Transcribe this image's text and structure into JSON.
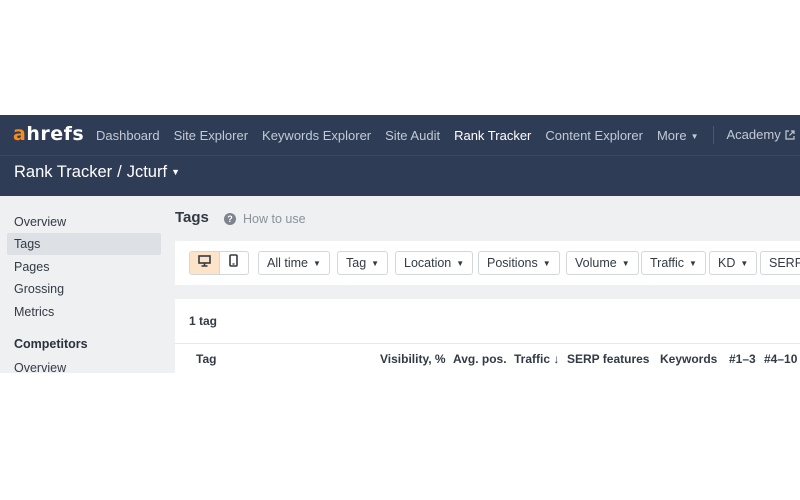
{
  "logo": {
    "first_letter": "a",
    "rest": "hrefs"
  },
  "nav": {
    "items": [
      {
        "label": "Dashboard"
      },
      {
        "label": "Site Explorer"
      },
      {
        "label": "Keywords Explorer"
      },
      {
        "label": "Site Audit"
      },
      {
        "label": "Rank Tracker"
      },
      {
        "label": "Content Explorer"
      }
    ],
    "more_label": "More",
    "academy_label": "Academy",
    "active": "Rank Tracker"
  },
  "project": {
    "tool": "Rank Tracker",
    "separator": "/",
    "name": "Jcturf"
  },
  "sidebar": {
    "items": [
      {
        "label": "Overview"
      },
      {
        "label": "Tags"
      },
      {
        "label": "Pages"
      },
      {
        "label": "Grossing"
      },
      {
        "label": "Metrics"
      }
    ],
    "active": "Tags",
    "section_heading": "Competitors",
    "section_items": [
      {
        "label": "Overview"
      }
    ]
  },
  "main": {
    "title": "Tags",
    "help_label": "How to use",
    "device_toggle": {
      "selected": "desktop",
      "options": [
        "desktop-icon",
        "mobile-icon"
      ]
    },
    "filters": [
      {
        "label": "All time"
      },
      {
        "label": "Tag"
      },
      {
        "label": "Location"
      },
      {
        "label": "Positions"
      },
      {
        "label": "Volume"
      },
      {
        "label": "Traffic"
      },
      {
        "label": "KD"
      },
      {
        "label": "SERP"
      }
    ],
    "tag_count": "1 tag",
    "table": {
      "columns": [
        "Tag",
        "Visibility, %",
        "Avg. pos.",
        "Traffic ↓",
        "SERP features",
        "Keywords",
        "#1–3",
        "#4–10"
      ]
    }
  },
  "colors": {
    "nav_bg": "#2e3c55",
    "logo_accent": "#f68c1f",
    "active_device_bg": "#fde3c8",
    "sidebar_bg": "#eef0f2",
    "sidebar_active_bg": "#dde1e6"
  }
}
